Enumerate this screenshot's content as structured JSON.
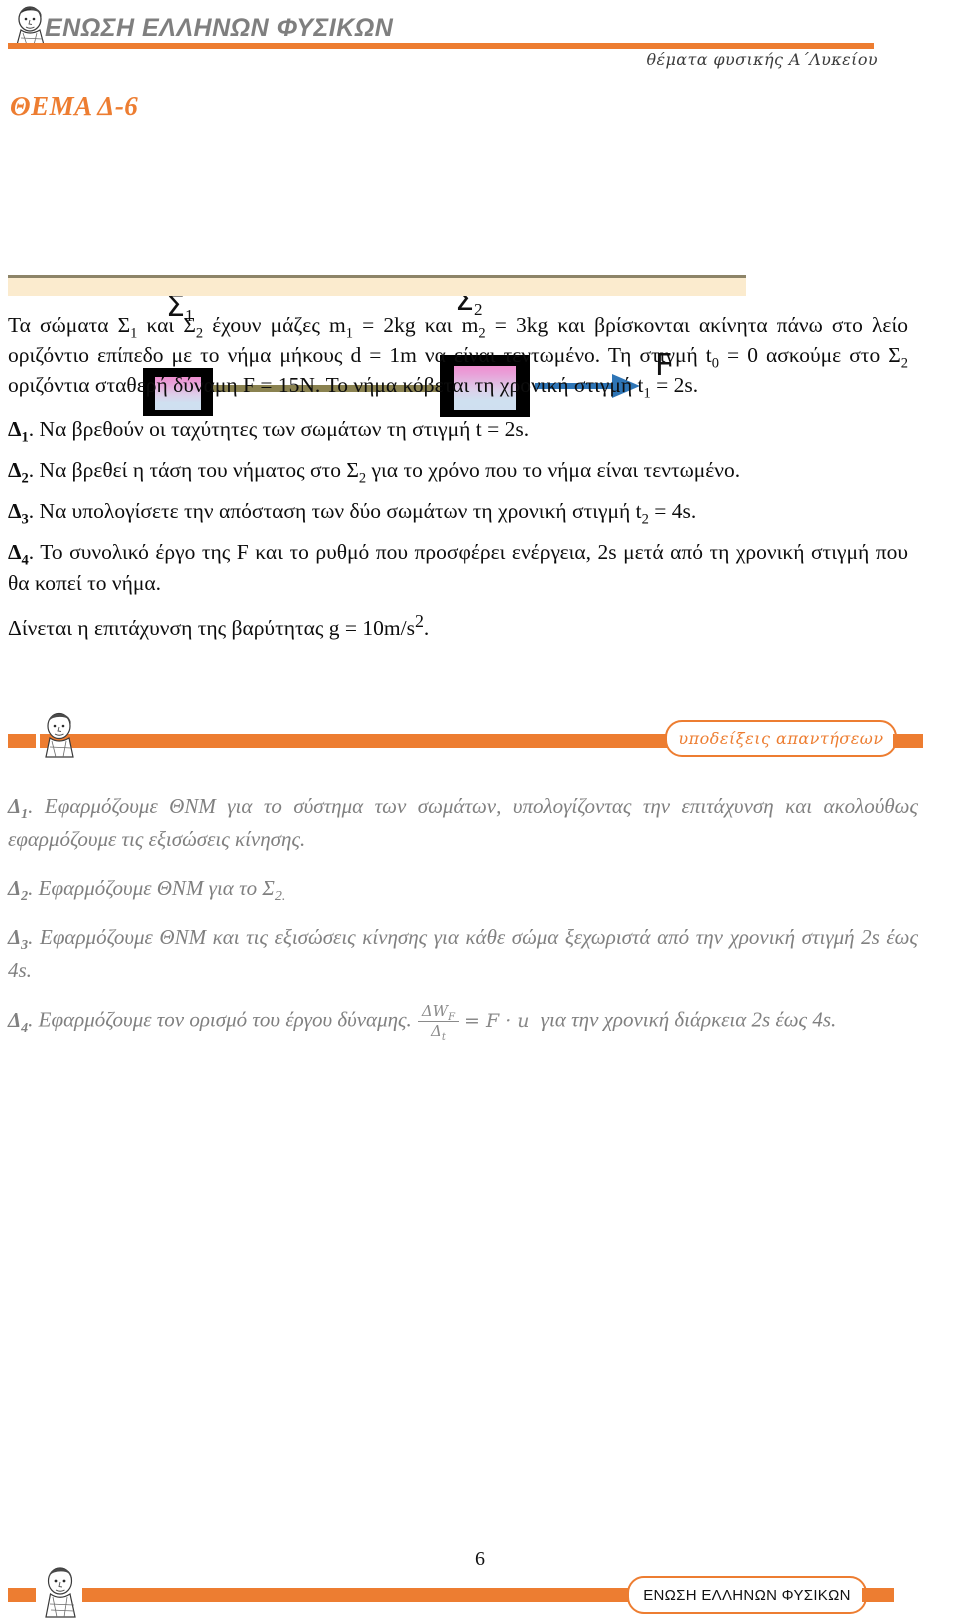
{
  "header": {
    "brand": "ΕΝΩΣΗ ΕΛΛΗΝΩΝ ΦΥΣΙΚΩΝ",
    "subtitle": "θέματα φυσικής Α΄Λυκείου",
    "logo_icon": "democritus-head-icon",
    "rule_color": "#ED7D31"
  },
  "title": "ΘΕΜΑ Δ-6",
  "figure": {
    "label_s1": "Σ",
    "label_s1_sub": "1",
    "label_s2": "Σ",
    "label_s2_sub": "2",
    "force_label": "F",
    "string_color": "#8A8250",
    "arrow_color": "#2E75B6",
    "ground_color": "#FBEBCE",
    "box_border_color": "#000000"
  },
  "problem": {
    "intro_line1": "Τα σώματα Σ",
    "intro": "Τα σώματα Σ₁ και Σ₂ έχουν μάζες m₁ = 2kg και m₂ = 3kg και βρίσκονται ακίνητα πάνω στο λείο οριζόντιο επίπεδο με το νήμα μήκους d = 1m να είναι τεντωμένο. Τη στιγμή t₀ = 0 ασκούμε στο Σ₂ οριζόντια σταθερή δύναμη F = 15N. Το νήμα κόβεται τη χρονική στιγμή t₁ = 2s.",
    "questions": [
      {
        "tag": "Δ",
        "tag_sub": "1",
        "text": ". Να βρεθούν οι ταχύτητες των σωμάτων τη στιγμή t = 2s."
      },
      {
        "tag": "Δ",
        "tag_sub": "2",
        "text": ". Να βρεθεί η τάση του νήματος στο Σ₂ για το χρόνο που το νήμα είναι τεντωμένο."
      },
      {
        "tag": "Δ",
        "tag_sub": "3",
        "text": ". Να υπολογίσετε την απόσταση των δύο σωμάτων τη χρονική στιγμή t₂ = 4s."
      },
      {
        "tag": "Δ",
        "tag_sub": "4",
        "text": ". Το συνολικό έργο της F και το ρυθμό που προσφέρει ενέργεια, 2s μετά από τη χρονική στιγμή που θα κοπεί το νήμα."
      }
    ],
    "given": "Δίνεται η επιτάχυνση της βαρύτητας g = 10m/s²."
  },
  "hints_divider": {
    "badge_label": "υποδείξεις απαντήσεων",
    "bar_color": "#ED7D31",
    "head_icon": "democritus-head-icon"
  },
  "hints": [
    {
      "tag": "Δ",
      "tag_sub": "1",
      "text": ".  Εφαρμόζουμε ΘΝΜ για το σύστημα των σωμάτων, υπολογίζοντας την επιτάχυνση και ακολούθως εφαρμόζουμε τις εξισώσεις κίνησης."
    },
    {
      "tag": "Δ",
      "tag_sub": "2",
      "text": ".  Εφαρμόζουμε ΘΝΜ για το Σ₂."
    },
    {
      "tag": "Δ",
      "tag_sub": "3",
      "text": ". Εφαρμόζουμε ΘΝΜ και τις εξισώσεις κίνησης για κάθε σώμα ξεχωριστά από την χρονική στιγμή 2s έως 4s."
    },
    {
      "tag": "Δ",
      "tag_sub": "4",
      "text_before": ". Εφαρμόζουμε τον ορισμό του έργου δύναμης.",
      "formula_num": "ΔW",
      "formula_num_sub": "F",
      "formula_den": "Δ",
      "formula_den_sub": "t",
      "formula_rhs": "= F · u",
      "text_after": "για την χρονική διάρκεια 2s έως 4s."
    }
  ],
  "footer": {
    "page_number": "6",
    "badge_label": "ΕΝΩΣΗ ΕΛΛΗΝΩΝ ΦΥΣΙΚΩΝ",
    "bar_color": "#ED7D31",
    "head_icon": "democritus-head-icon"
  }
}
